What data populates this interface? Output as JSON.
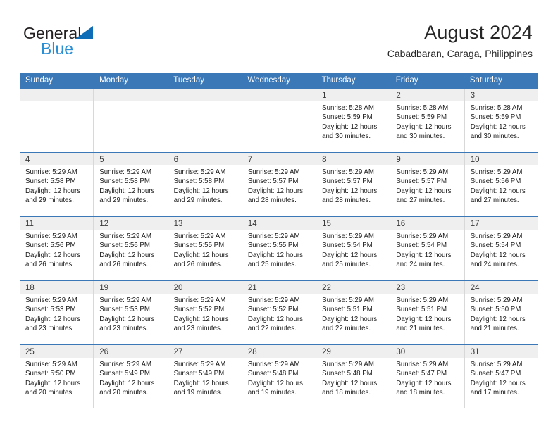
{
  "brand": {
    "name_part1": "General",
    "name_part2": "Blue",
    "triangle_icon": "triangle-icon",
    "accent_color": "#0f6cb6",
    "secondary_color": "#2b8fd6"
  },
  "header": {
    "title": "August 2024",
    "subtitle": "Cabadbaran, Caraga, Philippines"
  },
  "calendar": {
    "header_bg": "#3b78b8",
    "weekday_headers": [
      "Sunday",
      "Monday",
      "Tuesday",
      "Wednesday",
      "Thursday",
      "Friday",
      "Saturday"
    ],
    "weeks": [
      [
        {
          "day": "",
          "sunrise": "",
          "sunset": "",
          "daylight_line1": "",
          "daylight_line2": ""
        },
        {
          "day": "",
          "sunrise": "",
          "sunset": "",
          "daylight_line1": "",
          "daylight_line2": ""
        },
        {
          "day": "",
          "sunrise": "",
          "sunset": "",
          "daylight_line1": "",
          "daylight_line2": ""
        },
        {
          "day": "",
          "sunrise": "",
          "sunset": "",
          "daylight_line1": "",
          "daylight_line2": ""
        },
        {
          "day": "1",
          "sunrise": "Sunrise: 5:28 AM",
          "sunset": "Sunset: 5:59 PM",
          "daylight_line1": "Daylight: 12 hours",
          "daylight_line2": "and 30 minutes."
        },
        {
          "day": "2",
          "sunrise": "Sunrise: 5:28 AM",
          "sunset": "Sunset: 5:59 PM",
          "daylight_line1": "Daylight: 12 hours",
          "daylight_line2": "and 30 minutes."
        },
        {
          "day": "3",
          "sunrise": "Sunrise: 5:28 AM",
          "sunset": "Sunset: 5:59 PM",
          "daylight_line1": "Daylight: 12 hours",
          "daylight_line2": "and 30 minutes."
        }
      ],
      [
        {
          "day": "4",
          "sunrise": "Sunrise: 5:29 AM",
          "sunset": "Sunset: 5:58 PM",
          "daylight_line1": "Daylight: 12 hours",
          "daylight_line2": "and 29 minutes."
        },
        {
          "day": "5",
          "sunrise": "Sunrise: 5:29 AM",
          "sunset": "Sunset: 5:58 PM",
          "daylight_line1": "Daylight: 12 hours",
          "daylight_line2": "and 29 minutes."
        },
        {
          "day": "6",
          "sunrise": "Sunrise: 5:29 AM",
          "sunset": "Sunset: 5:58 PM",
          "daylight_line1": "Daylight: 12 hours",
          "daylight_line2": "and 29 minutes."
        },
        {
          "day": "7",
          "sunrise": "Sunrise: 5:29 AM",
          "sunset": "Sunset: 5:57 PM",
          "daylight_line1": "Daylight: 12 hours",
          "daylight_line2": "and 28 minutes."
        },
        {
          "day": "8",
          "sunrise": "Sunrise: 5:29 AM",
          "sunset": "Sunset: 5:57 PM",
          "daylight_line1": "Daylight: 12 hours",
          "daylight_line2": "and 28 minutes."
        },
        {
          "day": "9",
          "sunrise": "Sunrise: 5:29 AM",
          "sunset": "Sunset: 5:57 PM",
          "daylight_line1": "Daylight: 12 hours",
          "daylight_line2": "and 27 minutes."
        },
        {
          "day": "10",
          "sunrise": "Sunrise: 5:29 AM",
          "sunset": "Sunset: 5:56 PM",
          "daylight_line1": "Daylight: 12 hours",
          "daylight_line2": "and 27 minutes."
        }
      ],
      [
        {
          "day": "11",
          "sunrise": "Sunrise: 5:29 AM",
          "sunset": "Sunset: 5:56 PM",
          "daylight_line1": "Daylight: 12 hours",
          "daylight_line2": "and 26 minutes."
        },
        {
          "day": "12",
          "sunrise": "Sunrise: 5:29 AM",
          "sunset": "Sunset: 5:56 PM",
          "daylight_line1": "Daylight: 12 hours",
          "daylight_line2": "and 26 minutes."
        },
        {
          "day": "13",
          "sunrise": "Sunrise: 5:29 AM",
          "sunset": "Sunset: 5:55 PM",
          "daylight_line1": "Daylight: 12 hours",
          "daylight_line2": "and 26 minutes."
        },
        {
          "day": "14",
          "sunrise": "Sunrise: 5:29 AM",
          "sunset": "Sunset: 5:55 PM",
          "daylight_line1": "Daylight: 12 hours",
          "daylight_line2": "and 25 minutes."
        },
        {
          "day": "15",
          "sunrise": "Sunrise: 5:29 AM",
          "sunset": "Sunset: 5:54 PM",
          "daylight_line1": "Daylight: 12 hours",
          "daylight_line2": "and 25 minutes."
        },
        {
          "day": "16",
          "sunrise": "Sunrise: 5:29 AM",
          "sunset": "Sunset: 5:54 PM",
          "daylight_line1": "Daylight: 12 hours",
          "daylight_line2": "and 24 minutes."
        },
        {
          "day": "17",
          "sunrise": "Sunrise: 5:29 AM",
          "sunset": "Sunset: 5:54 PM",
          "daylight_line1": "Daylight: 12 hours",
          "daylight_line2": "and 24 minutes."
        }
      ],
      [
        {
          "day": "18",
          "sunrise": "Sunrise: 5:29 AM",
          "sunset": "Sunset: 5:53 PM",
          "daylight_line1": "Daylight: 12 hours",
          "daylight_line2": "and 23 minutes."
        },
        {
          "day": "19",
          "sunrise": "Sunrise: 5:29 AM",
          "sunset": "Sunset: 5:53 PM",
          "daylight_line1": "Daylight: 12 hours",
          "daylight_line2": "and 23 minutes."
        },
        {
          "day": "20",
          "sunrise": "Sunrise: 5:29 AM",
          "sunset": "Sunset: 5:52 PM",
          "daylight_line1": "Daylight: 12 hours",
          "daylight_line2": "and 23 minutes."
        },
        {
          "day": "21",
          "sunrise": "Sunrise: 5:29 AM",
          "sunset": "Sunset: 5:52 PM",
          "daylight_line1": "Daylight: 12 hours",
          "daylight_line2": "and 22 minutes."
        },
        {
          "day": "22",
          "sunrise": "Sunrise: 5:29 AM",
          "sunset": "Sunset: 5:51 PM",
          "daylight_line1": "Daylight: 12 hours",
          "daylight_line2": "and 22 minutes."
        },
        {
          "day": "23",
          "sunrise": "Sunrise: 5:29 AM",
          "sunset": "Sunset: 5:51 PM",
          "daylight_line1": "Daylight: 12 hours",
          "daylight_line2": "and 21 minutes."
        },
        {
          "day": "24",
          "sunrise": "Sunrise: 5:29 AM",
          "sunset": "Sunset: 5:50 PM",
          "daylight_line1": "Daylight: 12 hours",
          "daylight_line2": "and 21 minutes."
        }
      ],
      [
        {
          "day": "25",
          "sunrise": "Sunrise: 5:29 AM",
          "sunset": "Sunset: 5:50 PM",
          "daylight_line1": "Daylight: 12 hours",
          "daylight_line2": "and 20 minutes."
        },
        {
          "day": "26",
          "sunrise": "Sunrise: 5:29 AM",
          "sunset": "Sunset: 5:49 PM",
          "daylight_line1": "Daylight: 12 hours",
          "daylight_line2": "and 20 minutes."
        },
        {
          "day": "27",
          "sunrise": "Sunrise: 5:29 AM",
          "sunset": "Sunset: 5:49 PM",
          "daylight_line1": "Daylight: 12 hours",
          "daylight_line2": "and 19 minutes."
        },
        {
          "day": "28",
          "sunrise": "Sunrise: 5:29 AM",
          "sunset": "Sunset: 5:48 PM",
          "daylight_line1": "Daylight: 12 hours",
          "daylight_line2": "and 19 minutes."
        },
        {
          "day": "29",
          "sunrise": "Sunrise: 5:29 AM",
          "sunset": "Sunset: 5:48 PM",
          "daylight_line1": "Daylight: 12 hours",
          "daylight_line2": "and 18 minutes."
        },
        {
          "day": "30",
          "sunrise": "Sunrise: 5:29 AM",
          "sunset": "Sunset: 5:47 PM",
          "daylight_line1": "Daylight: 12 hours",
          "daylight_line2": "and 18 minutes."
        },
        {
          "day": "31",
          "sunrise": "Sunrise: 5:29 AM",
          "sunset": "Sunset: 5:47 PM",
          "daylight_line1": "Daylight: 12 hours",
          "daylight_line2": "and 17 minutes."
        }
      ]
    ]
  }
}
